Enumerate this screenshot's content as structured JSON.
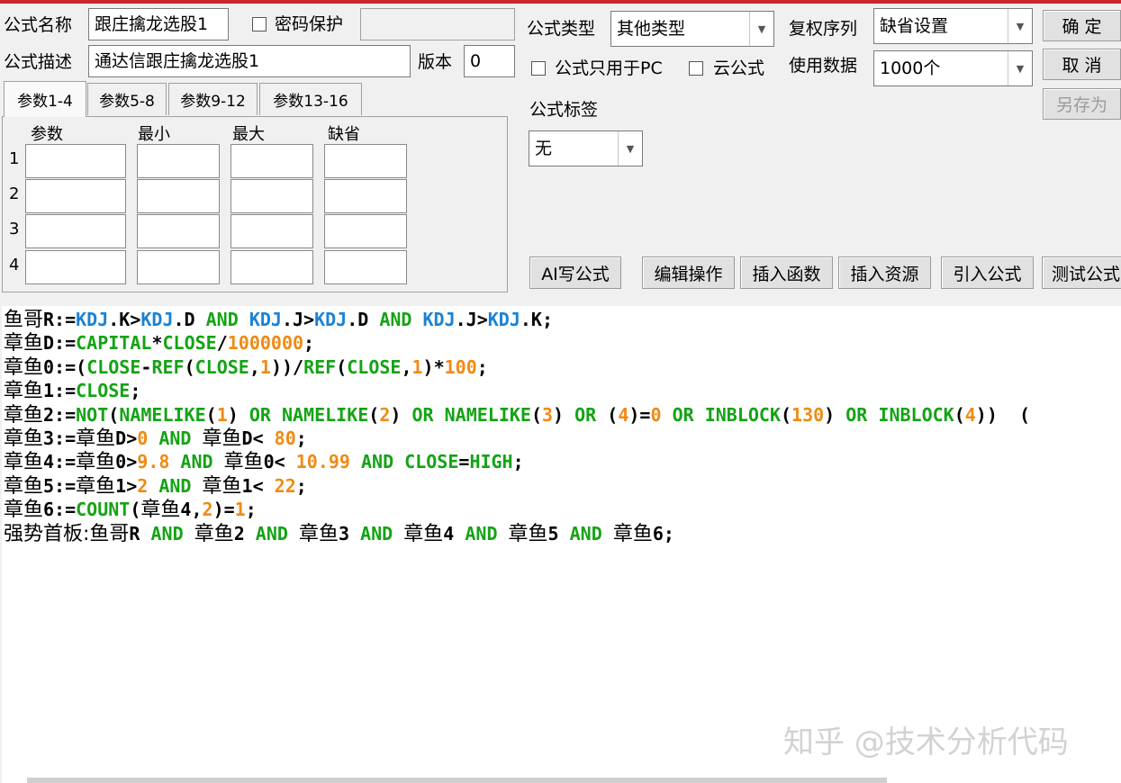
{
  "form": {
    "name_label": "公式名称",
    "name_value": "跟庄擒龙选股1",
    "password_label": "密码保护",
    "password_value": "",
    "desc_label": "公式描述",
    "desc_value": "通达信跟庄擒龙选股1",
    "version_label": "版本",
    "version_value": "0",
    "type_label": "公式类型",
    "type_value": "其他类型",
    "rights_label": "复权序列",
    "rights_value": "缺省设置",
    "pc_only_label": "公式只用于PC",
    "cloud_label": "云公式",
    "usedata_label": "使用数据",
    "usedata_value": "1000个",
    "tag_label": "公式标签",
    "tag_value": "无"
  },
  "buttons": {
    "ok": "确 定",
    "cancel": "取 消",
    "saveas": "另存为",
    "ai": "AI写公式",
    "edit": "编辑操作",
    "insert_func": "插入函数",
    "insert_res": "插入资源",
    "import": "引入公式",
    "test": "测试公式"
  },
  "tabs": [
    "参数1-4",
    "参数5-8",
    "参数9-12",
    "参数13-16"
  ],
  "params": {
    "headers": [
      "参数",
      "最小",
      "最大",
      "缺省"
    ],
    "rows": [
      "1",
      "2",
      "3",
      "4"
    ]
  },
  "code_lines": [
    [
      [
        "cn",
        "鱼哥"
      ],
      [
        "b",
        "R:="
      ],
      [
        "blue",
        "KDJ"
      ],
      [
        "b",
        ".K>"
      ],
      [
        "blue",
        "KDJ"
      ],
      [
        "b",
        ".D "
      ],
      [
        "green",
        "AND"
      ],
      [
        "b",
        " "
      ],
      [
        "blue",
        "KDJ"
      ],
      [
        "b",
        ".J>"
      ],
      [
        "blue",
        "KDJ"
      ],
      [
        "b",
        ".D "
      ],
      [
        "green",
        "AND"
      ],
      [
        "b",
        " "
      ],
      [
        "blue",
        "KDJ"
      ],
      [
        "b",
        ".J>"
      ],
      [
        "blue",
        "KDJ"
      ],
      [
        "b",
        ".K;"
      ]
    ],
    [
      [
        "cn",
        "章鱼"
      ],
      [
        "b",
        "D:="
      ],
      [
        "green",
        "CAPITAL"
      ],
      [
        "b",
        "*"
      ],
      [
        "green",
        "CLOSE"
      ],
      [
        "b",
        "/"
      ],
      [
        "orange",
        "1000000"
      ],
      [
        "b",
        ";"
      ]
    ],
    [
      [
        "cn",
        "章鱼"
      ],
      [
        "b",
        "0:=("
      ],
      [
        "green",
        "CLOSE"
      ],
      [
        "b",
        "-"
      ],
      [
        "green",
        "REF"
      ],
      [
        "b",
        "("
      ],
      [
        "green",
        "CLOSE"
      ],
      [
        "b",
        ","
      ],
      [
        "orange",
        "1"
      ],
      [
        "b",
        "))/"
      ],
      [
        "green",
        "REF"
      ],
      [
        "b",
        "("
      ],
      [
        "green",
        "CLOSE"
      ],
      [
        "b",
        ","
      ],
      [
        "orange",
        "1"
      ],
      [
        "b",
        ")*"
      ],
      [
        "orange",
        "100"
      ],
      [
        "b",
        ";"
      ]
    ],
    [
      [
        "cn",
        "章鱼"
      ],
      [
        "b",
        "1:="
      ],
      [
        "green",
        "CLOSE"
      ],
      [
        "b",
        ";"
      ]
    ],
    [
      [
        "cn",
        "章鱼"
      ],
      [
        "b",
        "2:="
      ],
      [
        "green",
        "NOT"
      ],
      [
        "b",
        "("
      ],
      [
        "green",
        "NAMELIKE"
      ],
      [
        "b",
        "("
      ],
      [
        "orange",
        "1"
      ],
      [
        "b",
        ") "
      ],
      [
        "green",
        "OR"
      ],
      [
        "b",
        " "
      ],
      [
        "green",
        "NAMELIKE"
      ],
      [
        "b",
        "("
      ],
      [
        "orange",
        "2"
      ],
      [
        "b",
        ") "
      ],
      [
        "green",
        "OR"
      ],
      [
        "b",
        " "
      ],
      [
        "green",
        "NAMELIKE"
      ],
      [
        "b",
        "("
      ],
      [
        "orange",
        "3"
      ],
      [
        "b",
        ") "
      ],
      [
        "green",
        "OR"
      ],
      [
        "b",
        " ("
      ],
      [
        "orange",
        "4"
      ],
      [
        "b",
        ")="
      ],
      [
        "orange",
        "0"
      ],
      [
        "b",
        " "
      ],
      [
        "green",
        "OR"
      ],
      [
        "b",
        " "
      ],
      [
        "green",
        "INBLOCK"
      ],
      [
        "b",
        "("
      ],
      [
        "orange",
        "130"
      ],
      [
        "b",
        ") "
      ],
      [
        "green",
        "OR"
      ],
      [
        "b",
        " "
      ],
      [
        "green",
        "INBLOCK"
      ],
      [
        "b",
        "("
      ],
      [
        "orange",
        "4"
      ],
      [
        "b",
        "))  ("
      ]
    ],
    [
      [
        "cn",
        "章鱼"
      ],
      [
        "b",
        "3:="
      ],
      [
        "cn",
        "章鱼"
      ],
      [
        "b",
        "D>"
      ],
      [
        "orange",
        "0"
      ],
      [
        "b",
        " "
      ],
      [
        "green",
        "AND"
      ],
      [
        "b",
        " "
      ],
      [
        "cn",
        "章鱼"
      ],
      [
        "b",
        "D< "
      ],
      [
        "orange",
        "80"
      ],
      [
        "b",
        ";"
      ]
    ],
    [
      [
        "cn",
        "章鱼"
      ],
      [
        "b",
        "4:="
      ],
      [
        "cn",
        "章鱼"
      ],
      [
        "b",
        "0>"
      ],
      [
        "orange",
        "9.8"
      ],
      [
        "b",
        " "
      ],
      [
        "green",
        "AND"
      ],
      [
        "b",
        " "
      ],
      [
        "cn",
        "章鱼"
      ],
      [
        "b",
        "0< "
      ],
      [
        "orange",
        "10.99"
      ],
      [
        "b",
        " "
      ],
      [
        "green",
        "AND"
      ],
      [
        "b",
        " "
      ],
      [
        "green",
        "CLOSE"
      ],
      [
        "b",
        "="
      ],
      [
        "green",
        "HIGH"
      ],
      [
        "b",
        ";"
      ]
    ],
    [
      [
        "cn",
        "章鱼"
      ],
      [
        "b",
        "5:="
      ],
      [
        "cn",
        "章鱼"
      ],
      [
        "b",
        "1>"
      ],
      [
        "orange",
        "2"
      ],
      [
        "b",
        " "
      ],
      [
        "green",
        "AND"
      ],
      [
        "b",
        " "
      ],
      [
        "cn",
        "章鱼"
      ],
      [
        "b",
        "1< "
      ],
      [
        "orange",
        "22"
      ],
      [
        "b",
        ";"
      ]
    ],
    [
      [
        "cn",
        "章鱼"
      ],
      [
        "b",
        "6:="
      ],
      [
        "green",
        "COUNT"
      ],
      [
        "b",
        "("
      ],
      [
        "cn",
        "章鱼"
      ],
      [
        "b",
        "4,"
      ],
      [
        "orange",
        "2"
      ],
      [
        "b",
        ")="
      ],
      [
        "orange",
        "1"
      ],
      [
        "b",
        ";"
      ]
    ],
    [
      [
        "cn",
        "强势首板:鱼哥"
      ],
      [
        "b",
        "R "
      ],
      [
        "green",
        "AND"
      ],
      [
        "b",
        " "
      ],
      [
        "cn",
        "章鱼"
      ],
      [
        "b",
        "2 "
      ],
      [
        "green",
        "AND"
      ],
      [
        "b",
        " "
      ],
      [
        "cn",
        "章鱼"
      ],
      [
        "b",
        "3 "
      ],
      [
        "green",
        "AND"
      ],
      [
        "b",
        " "
      ],
      [
        "cn",
        "章鱼"
      ],
      [
        "b",
        "4 "
      ],
      [
        "green",
        "AND"
      ],
      [
        "b",
        " "
      ],
      [
        "cn",
        "章鱼"
      ],
      [
        "b",
        "5 "
      ],
      [
        "green",
        "AND"
      ],
      [
        "b",
        " "
      ],
      [
        "cn",
        "章鱼"
      ],
      [
        "b",
        "6;"
      ]
    ]
  ],
  "watermark": "知乎 @技术分析代码",
  "colors": {
    "keyword": "#14a314",
    "indicator": "#1a82d6",
    "number": "#f08a14",
    "title_bar": "#c8282b"
  }
}
